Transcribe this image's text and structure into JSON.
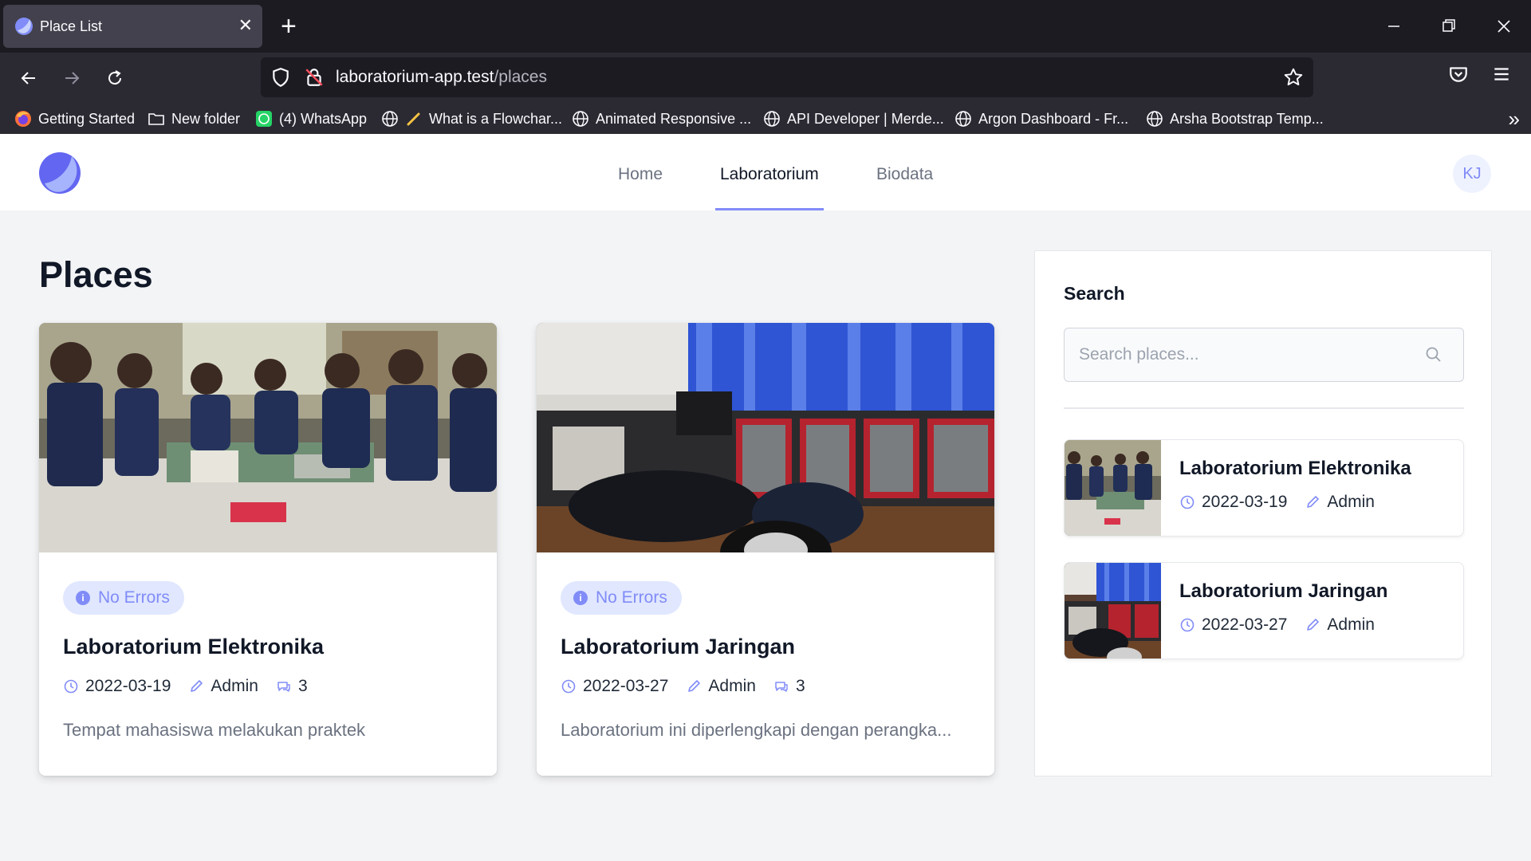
{
  "browser": {
    "tab_title": "Place List",
    "url_host": "laboratorium-app.test",
    "url_path": "/places",
    "bookmarks": [
      {
        "label": "Getting Started",
        "icon": "firefox-icon"
      },
      {
        "label": "New folder",
        "icon": "folder-icon"
      },
      {
        "label": "(4) WhatsApp",
        "icon": "whatsapp-icon"
      },
      {
        "label": "What is a Flowchar...",
        "icon": "globe-icon"
      },
      {
        "label": "Animated Responsive ...",
        "icon": "globe-icon"
      },
      {
        "label": "API Developer | Merde...",
        "icon": "globe-icon"
      },
      {
        "label": "Argon Dashboard - Fr...",
        "icon": "globe-icon"
      },
      {
        "label": "Arsha Bootstrap Temp...",
        "icon": "globe-icon"
      }
    ]
  },
  "header": {
    "nav": [
      {
        "label": "Home",
        "active": false
      },
      {
        "label": "Laboratorium",
        "active": true
      },
      {
        "label": "Biodata",
        "active": false
      }
    ],
    "avatar_initials": "KJ",
    "accent_color": "#818cf8"
  },
  "main": {
    "title": "Places",
    "cards": [
      {
        "badge": "No Errors",
        "title": "Laboratorium Elektronika",
        "date": "2022-03-19",
        "author": "Admin",
        "comments": "3",
        "description": "Tempat mahasiswa melakukan praktek"
      },
      {
        "badge": "No Errors",
        "title": "Laboratorium Jaringan",
        "date": "2022-03-27",
        "author": "Admin",
        "comments": "3",
        "description": "Laboratorium ini diperlengkapi dengan perangka..."
      }
    ]
  },
  "sidebar": {
    "title": "Search",
    "search_placeholder": "Search places...",
    "items": [
      {
        "title": "Laboratorium Elektronika",
        "date": "2022-03-19",
        "author": "Admin"
      },
      {
        "title": "Laboratorium Jaringan",
        "date": "2022-03-27",
        "author": "Admin"
      }
    ]
  }
}
